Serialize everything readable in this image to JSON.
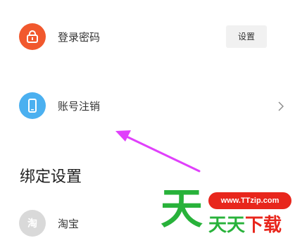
{
  "security": {
    "login_password": {
      "label": "登录密码",
      "icon": "lock-icon",
      "icon_color": "#f1582d",
      "action_label": "设置"
    },
    "account_cancel": {
      "label": "账号注销",
      "icon": "phone-icon",
      "icon_color": "#4bb0f0"
    }
  },
  "binding": {
    "title": "绑定设置",
    "items": [
      {
        "label": "淘宝",
        "icon_text": "淘",
        "icon_color": "#d9d9d9"
      }
    ]
  },
  "annotation": {
    "arrow_color": "#e040fb"
  },
  "watermark": {
    "big_text": "天",
    "url": "www.TTzip.com",
    "sub_text_green": "天天",
    "sub_text_red": "下载"
  }
}
